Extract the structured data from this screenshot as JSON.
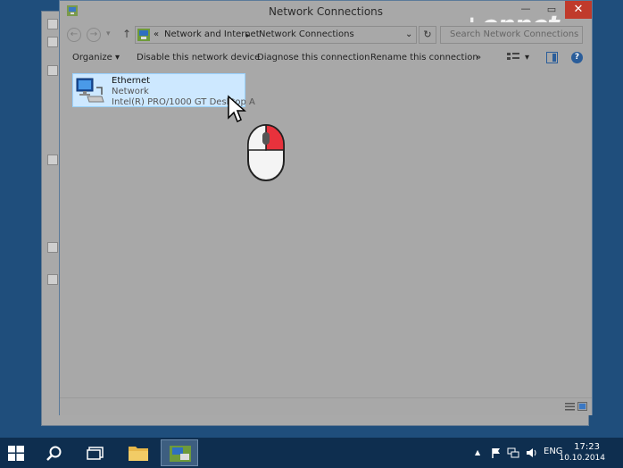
{
  "window": {
    "title": "Network Connections",
    "close": "✕",
    "minimize": "—",
    "maximize": "▭"
  },
  "watermark": "+onnet",
  "address_bar": {
    "prefix": "«",
    "crumbs": [
      "Network and Internet",
      "Network Connections"
    ],
    "separator": "▸",
    "dropdown": "⌄",
    "refresh": "↻"
  },
  "search": {
    "placeholder": "Search Network Connections"
  },
  "nav": {
    "back": "←",
    "forward": "→",
    "recent": "▾",
    "up": "↑"
  },
  "toolbar": {
    "organize": "Organize ▾",
    "disable": "Disable this network device",
    "diagnose": "Diagnose this connection",
    "rename": "Rename this connection",
    "more": "»",
    "view_dropdown": "▾",
    "help": "?"
  },
  "connection": {
    "name": "Ethernet",
    "status": "Network",
    "adapter": "Intel(R) PRO/1000 GT Desktop A"
  },
  "taskbar": {
    "language": "ENG",
    "time": "17:23",
    "date": "10.10.2014",
    "tray_arrow": "▲"
  },
  "colors": {
    "desktop": "#1f4e7c",
    "taskbar": "#0e2e4f",
    "selection": "#cde8ff",
    "close_button": "#c03a2b",
    "mouse_button_highlight": "#e8323c"
  }
}
